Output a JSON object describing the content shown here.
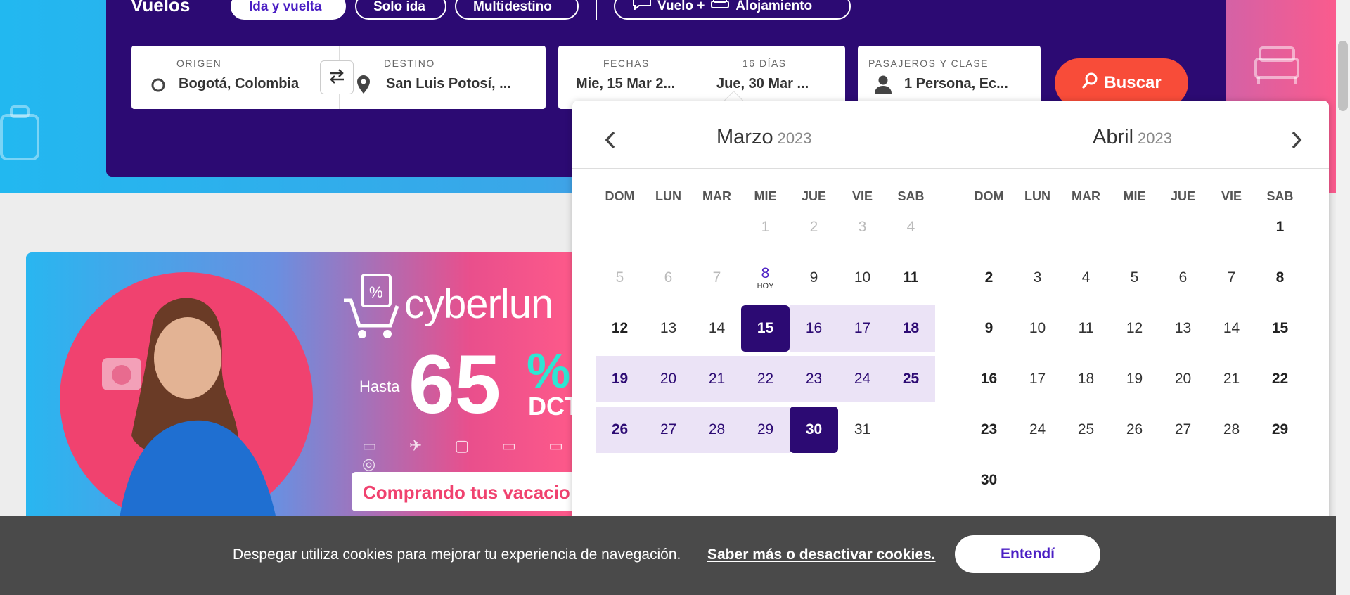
{
  "search": {
    "title": "Vuelos",
    "trip_types": [
      "Ida y vuelta",
      "Solo ida",
      "Multidestino"
    ],
    "combo_label": "Vuelo +",
    "combo_label2": "Alojamiento",
    "origin_label": "ORIGEN",
    "origin_value": "Bogotá, Colombia",
    "destination_label": "DESTINO",
    "destination_value": "San Luis Potosí, ...",
    "dates_label": "FECHAS",
    "depart_value": "Mie, 15 Mar 2...",
    "days_label": "16 DÍAS",
    "return_value": "Jue, 30 Mar ...",
    "pax_label": "PASAJEROS Y CLASE",
    "pax_value": "1 Persona, Ec...",
    "search_button": "Buscar"
  },
  "calendar": {
    "weekdays": [
      "DOM",
      "LUN",
      "MAR",
      "MIE",
      "JUE",
      "VIE",
      "SAB"
    ],
    "left_month": "Marzo",
    "left_year": "2023",
    "right_month": "Abril",
    "right_year": "2023",
    "today_label": "HOY",
    "selected_start": 15,
    "selected_end": 30,
    "accent": "#2c0a73"
  },
  "promo": {
    "brand": "cyberlun",
    "prefix": "Hasta",
    "value": "65",
    "percent": "%",
    "dct": "DCT",
    "tagline": "Comprando tus vacacio"
  },
  "cookies": {
    "text": "Despegar utiliza cookies para mejorar tu experiencia de navegación.",
    "link": "Saber más o desactivar cookies.",
    "button": "Entendí"
  }
}
